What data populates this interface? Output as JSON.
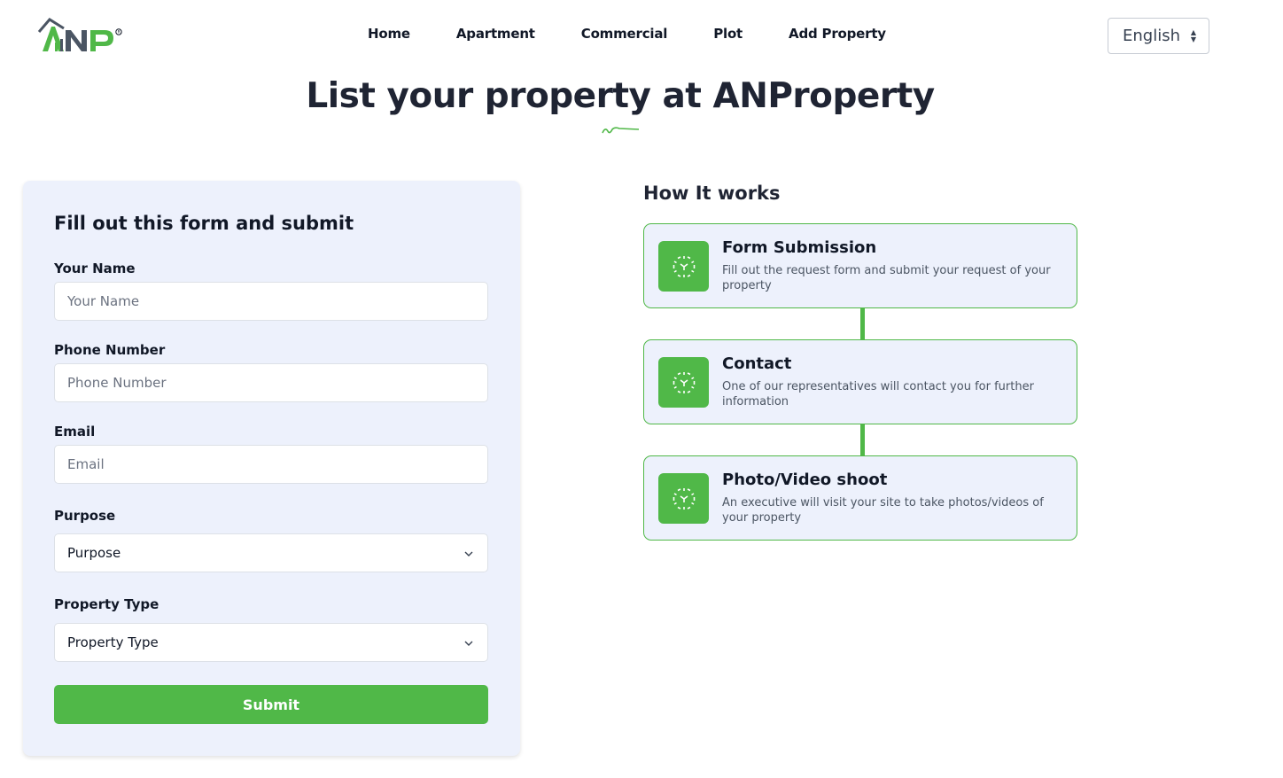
{
  "header": {
    "logo_text": "ANP",
    "nav": [
      "Home",
      "Apartment",
      "Commercial",
      "Plot",
      "Add Property"
    ],
    "language": "English"
  },
  "hero": {
    "title": "List your property at ANProperty"
  },
  "form": {
    "heading": "Fill out this form and submit",
    "fields": [
      {
        "label": "Your Name",
        "placeholder": "Your Name"
      },
      {
        "label": "Phone Number",
        "placeholder": "Phone Number"
      },
      {
        "label": "Email",
        "placeholder": "Email"
      }
    ],
    "selects": [
      {
        "label": "Purpose",
        "value": "Purpose"
      },
      {
        "label": "Property Type",
        "value": "Property Type"
      }
    ],
    "submit_label": "Submit"
  },
  "how_it_works": {
    "title": "How It works",
    "steps": [
      {
        "title": "Form Submission",
        "description": "Fill out the request form and submit your request of your property",
        "icon": "scan-icon"
      },
      {
        "title": "Contact",
        "description": "One of our representatives will contact you for further information",
        "icon": "scan-icon"
      },
      {
        "title": "Photo/Video shoot",
        "description": "An executive will visit your site to take photos/videos of your property",
        "icon": "scan-icon"
      }
    ]
  },
  "colors": {
    "accent": "#50b848",
    "card_bg": "#edf1fc",
    "text": "#111827"
  }
}
